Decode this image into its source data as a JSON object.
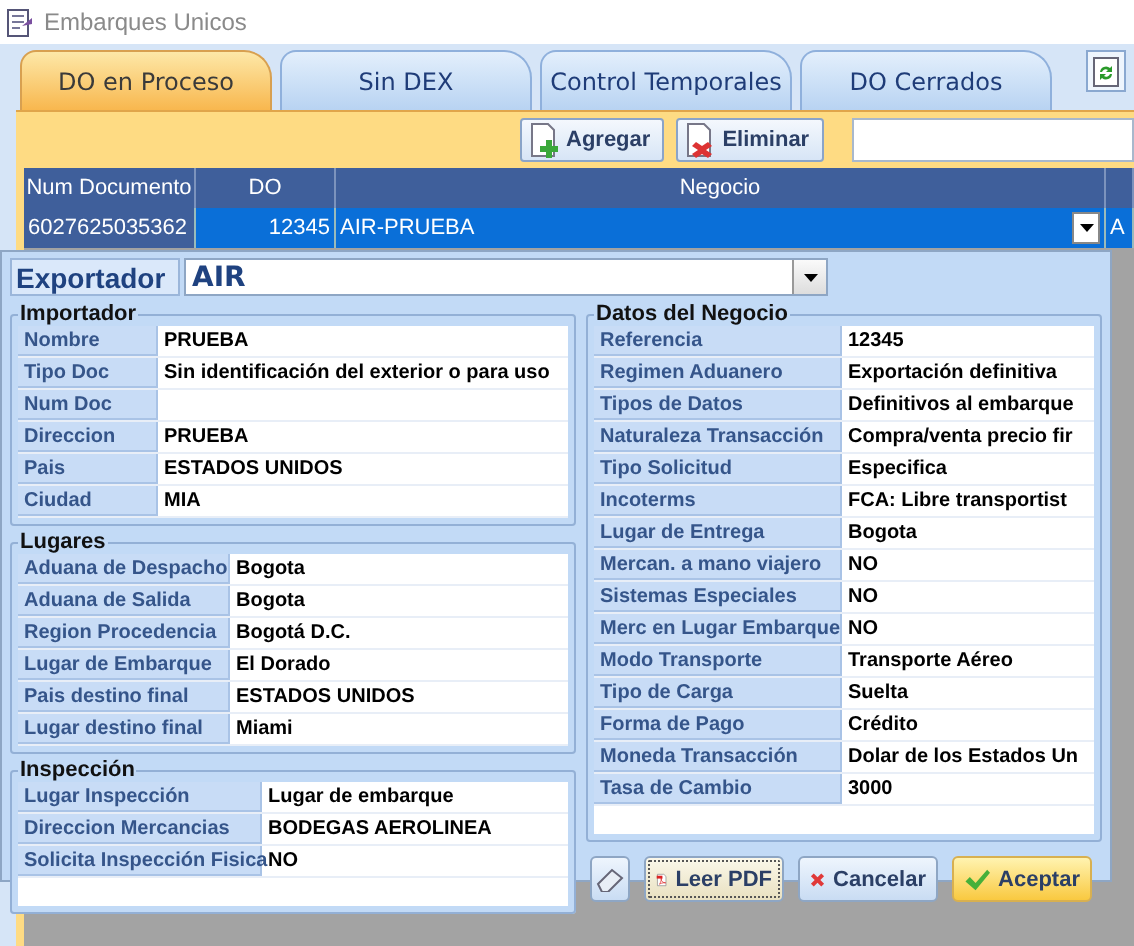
{
  "window": {
    "title": "Embarques Unicos"
  },
  "tabs": [
    {
      "label": "DO en Proceso",
      "selected": true
    },
    {
      "label": "Sin DEX",
      "selected": false
    },
    {
      "label": "Control Temporales",
      "selected": false
    },
    {
      "label": "DO Cerrados",
      "selected": false
    }
  ],
  "toolbar": {
    "buttons": [
      {
        "label": "Agregar",
        "kind": "add"
      },
      {
        "label": "Eliminar",
        "kind": "delete"
      }
    ]
  },
  "grid": {
    "columns": [
      "Num Documento",
      "DO",
      "Negocio"
    ],
    "rows": [
      {
        "cells": [
          "6027625035362",
          "12345",
          "AIR-PRUEBA",
          "A"
        ],
        "selected": true
      }
    ]
  },
  "dialog": {
    "exportador": {
      "label": "Exportador",
      "value": "AIR"
    },
    "left_sections": [
      {
        "title": "Importador",
        "rows": [
          {
            "label": "Nombre",
            "value": "PRUEBA"
          },
          {
            "label": "Tipo Doc",
            "value": "Sin identificación del exterior o para uso"
          },
          {
            "label": "Num Doc"
          },
          {
            "label": "Direccion",
            "value": "PRUEBA"
          },
          {
            "label": "Pais",
            "value": "ESTADOS UNIDOS"
          },
          {
            "label": "Ciudad",
            "value": "MIA"
          }
        ]
      },
      {
        "title": "Lugares",
        "rows": [
          {
            "label": "Aduana de Despacho",
            "value": "Bogota"
          },
          {
            "label": "Aduana de Salida",
            "value": "Bogota"
          },
          {
            "label": "Region Procedencia",
            "value": "Bogotá D.C."
          },
          {
            "label": "Lugar de Embarque",
            "value": "El Dorado"
          },
          {
            "label": "Pais destino  final",
            "value": "ESTADOS UNIDOS"
          },
          {
            "label": "Lugar destino final",
            "value": "Miami"
          }
        ]
      },
      {
        "title": "Inspección",
        "rows": [
          {
            "label": "Lugar Inspección",
            "value": "Lugar de embarque"
          },
          {
            "label": "Direccion Mercancias",
            "value": "BODEGAS AEROLINEA"
          },
          {
            "label": "Solicita Inspección Fisica",
            "value": "NO"
          }
        ]
      }
    ],
    "negocio": {
      "title": "Datos del Negocio",
      "rows": [
        {
          "label": "Referencia",
          "value": "12345"
        },
        {
          "label": "Regimen Aduanero",
          "value": "Exportación definitiva"
        },
        {
          "label": "Tipos de Datos",
          "value": "Definitivos al embarque"
        },
        {
          "label": "Naturaleza Transacción",
          "value": "Compra/venta precio fir"
        },
        {
          "label": "Tipo Solicitud",
          "value": "Especifica"
        },
        {
          "label": "Incoterms",
          "value": "FCA: Libre transportist"
        },
        {
          "label": "Lugar de Entrega",
          "value": "Bogota"
        },
        {
          "label": "Mercan. a mano viajero",
          "value": "NO"
        },
        {
          "label": "Sistemas Especiales",
          "value": "NO"
        },
        {
          "label": "Merc en Lugar Embarque",
          "value": "NO"
        },
        {
          "label": "Modo Transporte",
          "value": "Transporte Aéreo"
        },
        {
          "label": "Tipo de Carga",
          "value": "Suelta"
        },
        {
          "label": "Forma de Pago",
          "value": "Crédito"
        },
        {
          "label": "Moneda Transacción",
          "value": "Dolar de los Estados Un"
        },
        {
          "label": "Tasa de Cambio",
          "value": "3000"
        }
      ]
    },
    "buttons": [
      {
        "kind": "erase"
      },
      {
        "label": "Leer PDF",
        "kind": "pdf"
      },
      {
        "label": "Cancelar",
        "kind": "cancel"
      },
      {
        "label": "Aceptar",
        "kind": "accept"
      }
    ]
  }
}
